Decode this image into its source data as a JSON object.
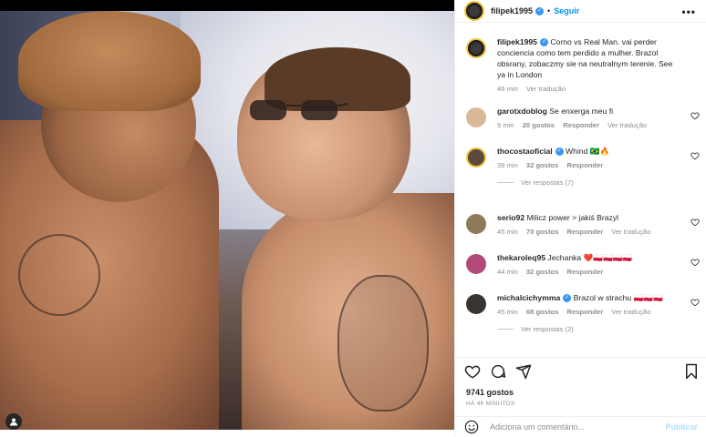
{
  "post": {
    "username": "filipek1995",
    "follow_label": "Seguir",
    "more_label": "•••",
    "caption": "Corno vs Real Man. vai perder conciencia como tem perdido a mulher. Brazol obsrany, zobaczmy sie na neutralnym terenie. See ya in London",
    "caption_time": "46 min",
    "caption_translate": "Ver tradução"
  },
  "comments": [
    {
      "user": "garotxdoblog",
      "text": "Se enxerga meu fi",
      "time": "9 min",
      "likes": "20 gostos",
      "reply": "Responder",
      "translate": "Ver tradução",
      "avatar_color": "#d9b89a"
    },
    {
      "user": "thocostaoficial",
      "verified": true,
      "text": "Whind 🇧🇷🔥",
      "time": "39 min",
      "likes": "32 gostos",
      "reply": "Responder",
      "translate": "",
      "view_replies": "Ver respostas (7)",
      "avatar_color": "#5b4a3e"
    },
    {
      "user": "serio92",
      "text": "Milicz power > jakiś Brazyl",
      "time": "45 min",
      "likes": "70 gostos",
      "reply": "Responder",
      "translate": "Ver tradução",
      "avatar_color": "#8e7a58"
    },
    {
      "user": "thekaroleq95",
      "text": "Jechanka ❤️🇵🇱🇵🇱🇵🇱🇵🇱",
      "time": "44 min",
      "likes": "32 gostos",
      "reply": "Responder",
      "translate": "",
      "avatar_color": "#b04a7a"
    },
    {
      "user": "michalcichymma",
      "verified": true,
      "text": "Brazol w strachu 🇵🇱🇵🇱🇵🇱",
      "time": "45 min",
      "likes": "68 gostos",
      "reply": "Responder",
      "translate": "Ver tradução",
      "view_replies": "Ver respostas (2)",
      "avatar_color": "#3a3430"
    }
  ],
  "footer": {
    "likes": "9741 gostos",
    "date": "HÁ 46 MINUTOS",
    "comment_placeholder": "Adiciona um comentário...",
    "publish_label": "Publicar"
  },
  "icons": [
    "verified-icon",
    "heart-icon",
    "comment-icon",
    "share-icon",
    "save-icon",
    "emoji-icon",
    "user-tag-icon",
    "more-icon"
  ],
  "colors": {
    "accent": "#0095f6",
    "verified": "#3897f0",
    "muted": "#8e8e8e",
    "text": "#262626"
  }
}
